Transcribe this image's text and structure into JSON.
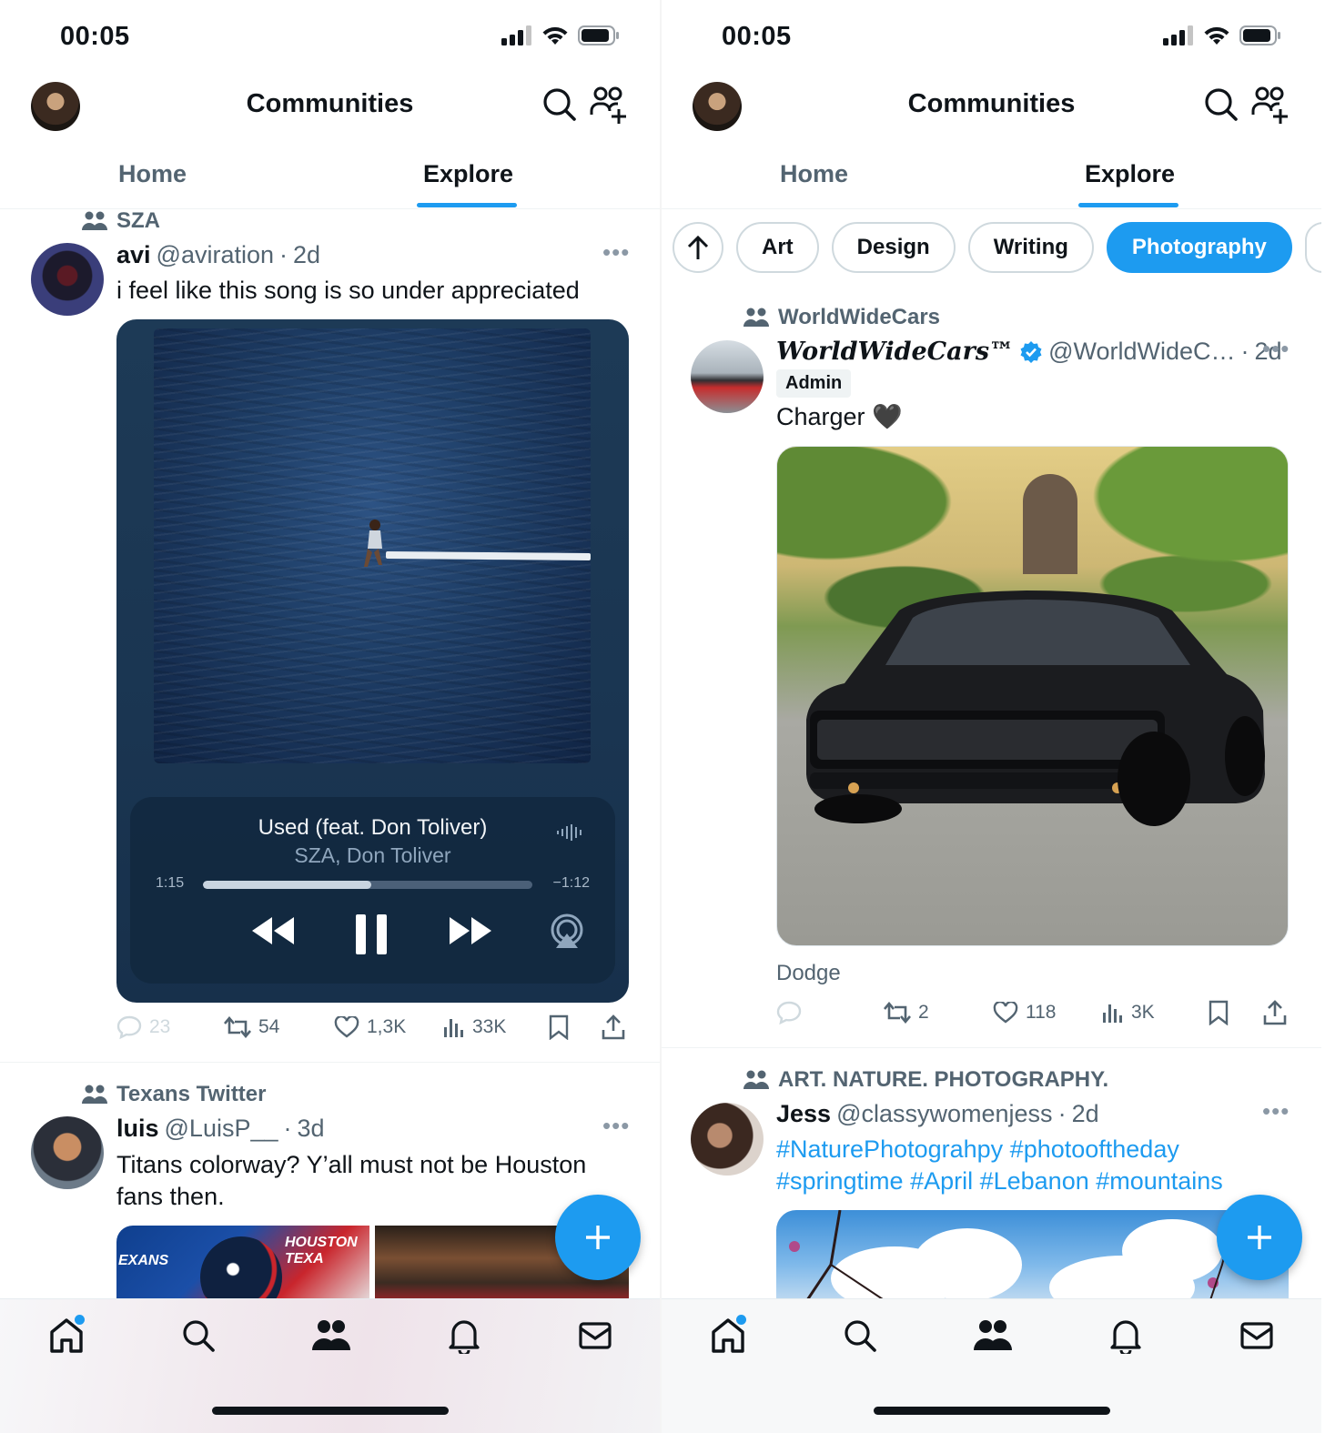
{
  "colors": {
    "accent": "#1d9bf0",
    "text": "#0f1419",
    "muted": "#536471"
  },
  "left_screen": {
    "status": {
      "time": "00:05"
    },
    "header": {
      "title": "Communities"
    },
    "tabs": [
      {
        "label": "Home"
      },
      {
        "label": "Explore",
        "active": true
      }
    ],
    "posts": [
      {
        "community": "SZA",
        "name": "avi",
        "handle": "@aviration",
        "age": "2d",
        "text": "i feel like this song is so under appreciated",
        "media": {
          "song": "Used (feat. Don Toliver)",
          "artist": "SZA, Don Toliver",
          "elapsed": "1:15",
          "remaining": "−1:12",
          "progress": 0.51
        },
        "stats": {
          "replies": "23",
          "reposts": "54",
          "likes": "1,3K",
          "views": "33K"
        }
      },
      {
        "community": "Texans Twitter",
        "name": "luis",
        "handle": "@LuisP__",
        "age": "3d",
        "text": "Titans colorway? Y’all must not be Houston fans then.",
        "media_text": [
          "EXANS",
          "HOUSTON TEXA"
        ]
      }
    ]
  },
  "right_screen": {
    "status": {
      "time": "00:05"
    },
    "header": {
      "title": "Communities"
    },
    "tabs": [
      {
        "label": "Home"
      },
      {
        "label": "Explore",
        "active": true
      }
    ],
    "chips": [
      "Art",
      "Design",
      "Writing",
      "Photography"
    ],
    "active_chip": "Photography",
    "posts": [
      {
        "community": "WorldWideCars",
        "name": "WorldWideCars™",
        "verified": true,
        "handle": "@WorldWideC…",
        "age": "2d",
        "badge": "Admin",
        "text": "Charger 🖤",
        "caption": "Dodge",
        "stats": {
          "replies": "",
          "reposts": "2",
          "likes": "118",
          "views": "3K"
        }
      },
      {
        "community": "ART. NATURE. PHOTOGRAPHY.",
        "name": "Jess",
        "handle": "@classywomenjess",
        "age": "2d",
        "hashtags": "#NaturePhotograhpy #photooftheday #springtime #April #Lebanon #mountains"
      }
    ]
  },
  "icons": [
    "signal-icon",
    "wifi-icon",
    "battery-icon",
    "search-icon",
    "add-community-icon",
    "community-icon",
    "more-icon",
    "reply-icon",
    "repost-icon",
    "like-icon",
    "views-icon",
    "bookmark-icon",
    "share-icon",
    "home-icon",
    "people-icon",
    "bell-icon",
    "mail-icon",
    "plus-icon",
    "arrow-up-icon",
    "verified-icon",
    "rewind-icon",
    "pause-icon",
    "forward-icon",
    "airplay-icon"
  ]
}
